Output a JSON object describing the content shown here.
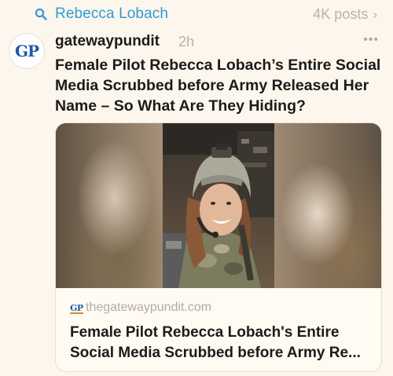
{
  "search": {
    "query": "Rebecca Lobach",
    "results_count": "4K posts",
    "chevron": "›"
  },
  "post": {
    "avatar_initials": "GP",
    "source_name": "gatewaypundit",
    "time": "2h",
    "more": "•••",
    "headline": "Female Pilot Rebecca Lobach’s Entire Social Media Scrubbed before Army Released Her Name – So What Are They Hiding?",
    "link_card": {
      "logo_text": "GP",
      "domain": "thegatewaypundit.com",
      "title": "Female Pilot Rebecca Lobach's Entire Social Media Scrubbed before Army Re..."
    }
  },
  "colors": {
    "accent": "#2f9bd8",
    "background": "#fdf6ec",
    "muted": "#b8b3ab",
    "gp_blue": "#1f5aa8"
  }
}
